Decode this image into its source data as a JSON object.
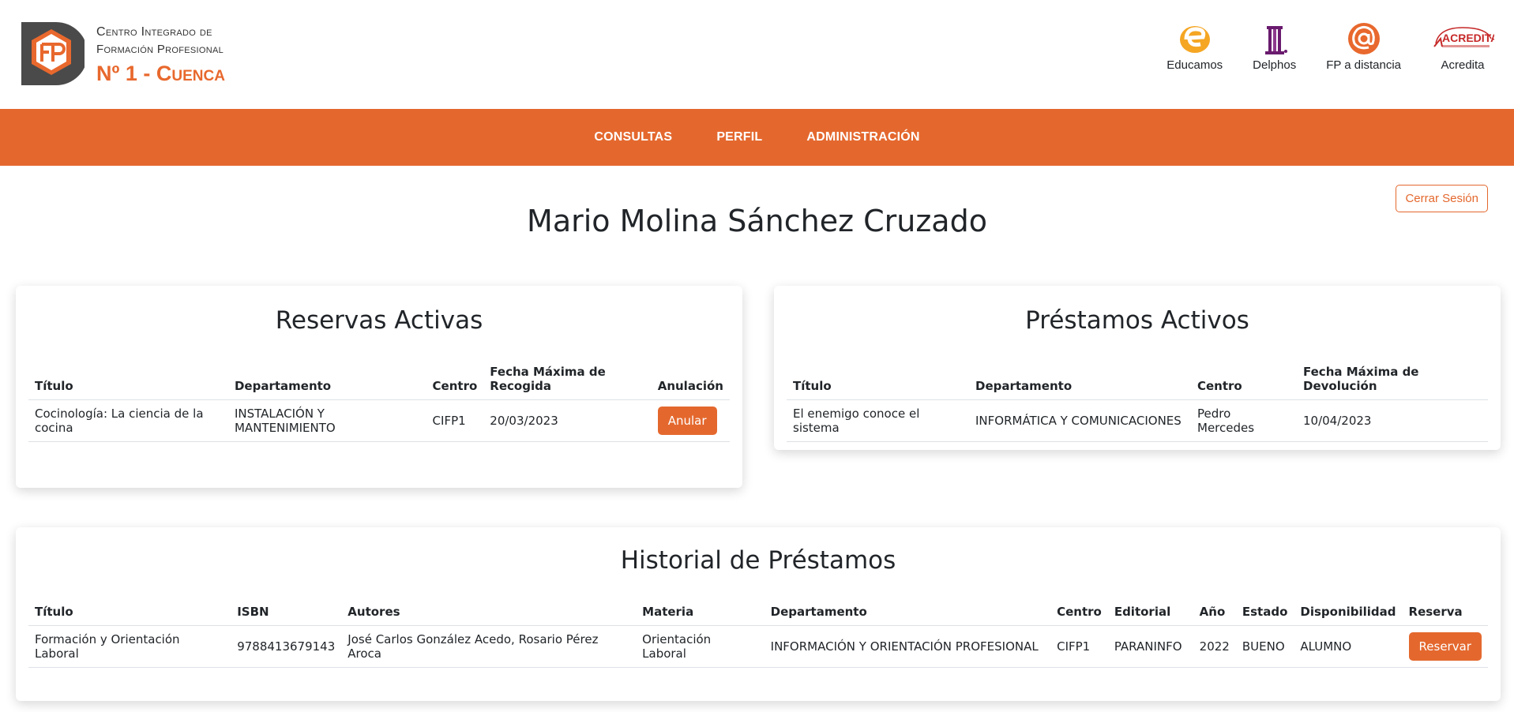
{
  "header": {
    "school_line1": "Centro Integrado de",
    "school_line2": "Formación Profesional",
    "school_line3": "Nº 1 - Cuenca",
    "links": [
      {
        "label": "Educamos",
        "icon": "educamos-icon"
      },
      {
        "label": "Delphos",
        "icon": "delphos-icon"
      },
      {
        "label": "FP a distancia",
        "icon": "fp-distancia-icon"
      },
      {
        "label": "Acredita",
        "icon": "acredita-icon"
      }
    ],
    "acredita_logo_text": "ACREDITA"
  },
  "nav": {
    "items": [
      "CONSULTAS",
      "PERFIL",
      "ADMINISTRACIÓN"
    ]
  },
  "logout_label": "Cerrar Sesión",
  "user_name": "Mario Molina Sánchez Cruzado",
  "reservas": {
    "title": "Reservas Activas",
    "columns": [
      "Título",
      "Departamento",
      "Centro",
      "Fecha Máxima de Recogida",
      "Anulación"
    ],
    "rows": [
      {
        "titulo": "Cocinología: La ciencia de la cocina",
        "departamento": "INSTALACIÓN Y MANTENIMIENTO",
        "centro": "CIFP1",
        "fecha": "20/03/2023",
        "action": "Anular"
      }
    ]
  },
  "prestamos": {
    "title": "Préstamos Activos",
    "columns": [
      "Título",
      "Departamento",
      "Centro",
      "Fecha Máxima de Devolución"
    ],
    "rows": [
      {
        "titulo": "El enemigo conoce el sistema",
        "departamento": "INFORMÁTICA Y COMUNICACIONES",
        "centro": "Pedro Mercedes",
        "fecha": "10/04/2023"
      }
    ]
  },
  "historial": {
    "title": "Historial de Préstamos",
    "columns": [
      "Título",
      "ISBN",
      "Autores",
      "Materia",
      "Departamento",
      "Centro",
      "Editorial",
      "Año",
      "Estado",
      "Disponibilidad",
      "Reserva"
    ],
    "rows": [
      {
        "titulo": "Formación y Orientación Laboral",
        "isbn": "9788413679143",
        "autores": "José Carlos González Acedo, Rosario Pérez Aroca",
        "materia": "Orientación Laboral",
        "departamento": "INFORMACIÓN Y ORIENTACIÓN PROFESIONAL",
        "centro": "CIFP1",
        "editorial": "PARANINFO",
        "anio": "2022",
        "estado": "BUENO",
        "disponibilidad": "ALUMNO",
        "action": "Reservar"
      }
    ]
  },
  "colors": {
    "accent": "#e4682e",
    "text": "#212529"
  }
}
